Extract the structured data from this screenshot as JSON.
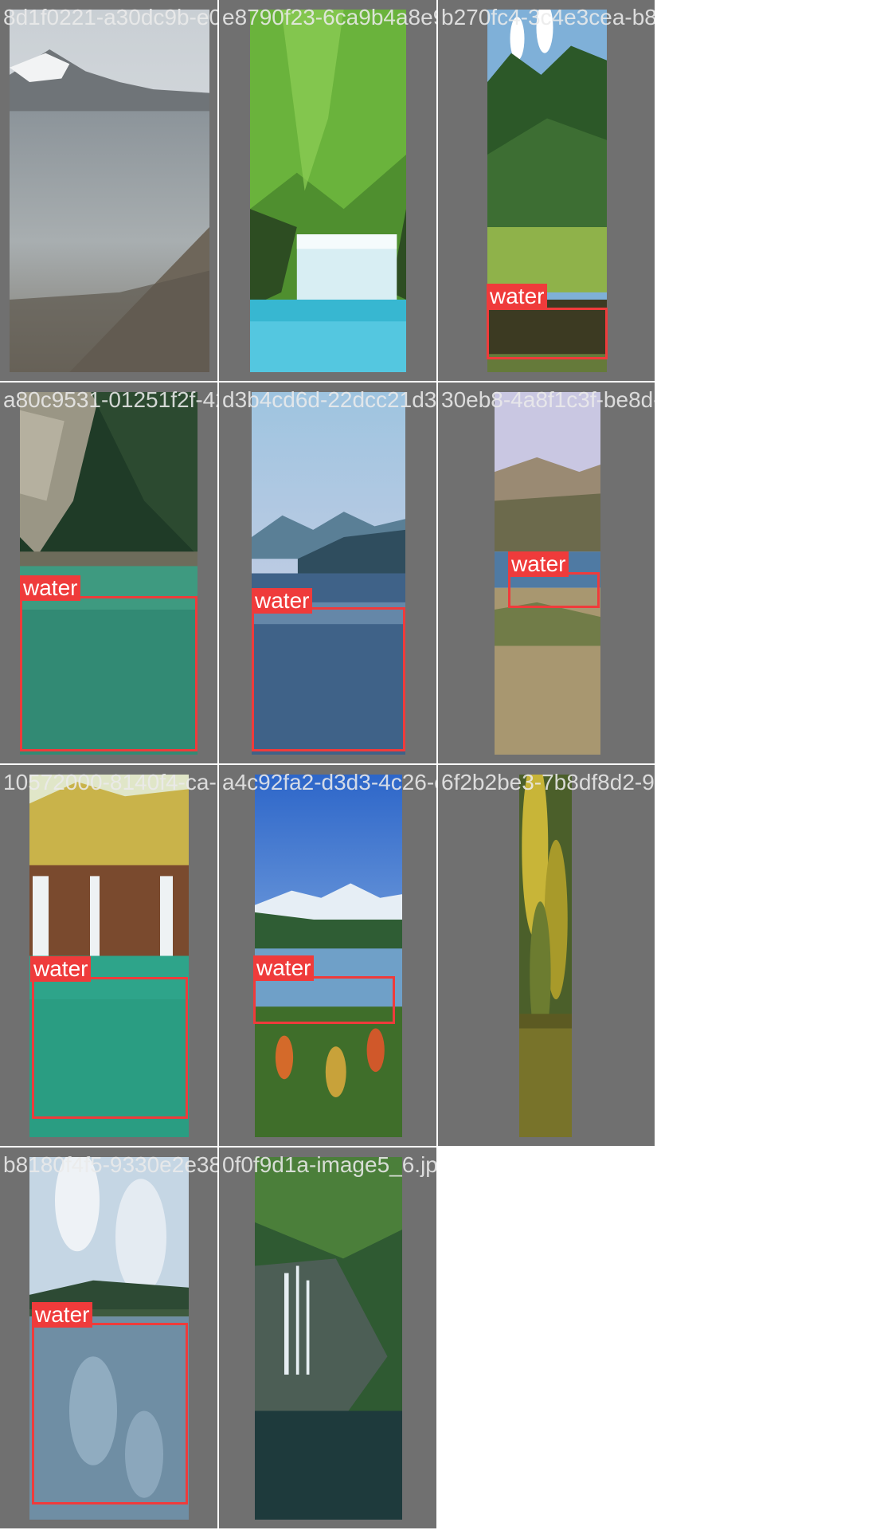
{
  "tiles": [
    {
      "filename": "8d1f0221-a30dc9b-e0298cb9-fda6a4d-1c25775e3d4d83ecea-bcf5",
      "label": ""
    },
    {
      "filename": "e8790f23-6ca9b4a8e9-patagonia-",
      "label": ""
    },
    {
      "filename": "b270fc4-3c4e3cea-b8e1-c2f198d9-landscape",
      "label": "water"
    },
    {
      "filename": "a80c9531-01251f2f-4297-4c99-nature-ab9ed16e44e1d5be-d4a-1e2a-images_2.j",
      "label": "water"
    },
    {
      "filename": "d3b4cd6d-22dcc21d385-2a4e1a1d-4d42-16b4",
      "label": "water"
    },
    {
      "filename": "30eb8-4a8f1c3f-be8d-5af-190",
      "label": "water"
    },
    {
      "filename": "10572000-8140f4-ca-a3983f25-27ce-a5718420c6d-7aa4e6-3c6397c203-trees-253",
      "label": "water"
    },
    {
      "filename": "a4c92fa2-d3d3-4c26-c8a1-71bfd26",
      "label": "water"
    },
    {
      "filename": "6f2b2be3-7b8df8d2-9d1c-5b5",
      "label": ""
    },
    {
      "filename": "b8180f4f5-9330e2e3874-6fd0f829-i79959-d-0c0b29344faf-bella-colecci",
      "label": "water"
    },
    {
      "filename": "0f0f9d1a-image5_6.jpeg",
      "label": ""
    }
  ],
  "colors": {
    "background": "#707070",
    "box": "#ef3b3b",
    "label_text": "#ffffff"
  }
}
